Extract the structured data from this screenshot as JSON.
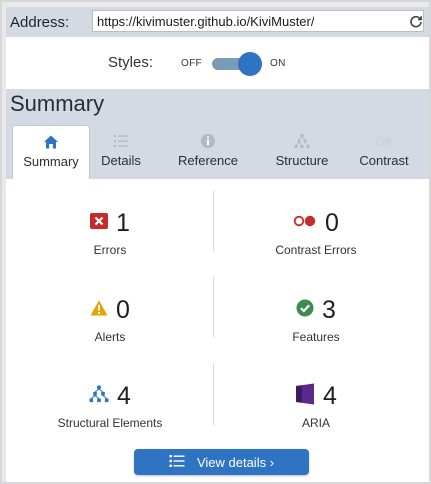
{
  "address": {
    "label": "Address:",
    "value": "https://kivimuster.github.io/KiviMuster/",
    "reload_icon": "reload-icon"
  },
  "styles": {
    "label": "Styles:",
    "off_label": "OFF",
    "on_label": "ON",
    "enabled": true
  },
  "summary": {
    "title": "Summary"
  },
  "tabs": [
    {
      "label": "Summary",
      "icon": "home-icon",
      "active": true
    },
    {
      "label": "Details",
      "icon": "list-icon",
      "active": false
    },
    {
      "label": "Reference",
      "icon": "info-icon",
      "active": false
    },
    {
      "label": "Structure",
      "icon": "hierarchy-icon",
      "active": false
    },
    {
      "label": "Contrast",
      "icon": "contrast-icon",
      "active": false
    }
  ],
  "metrics": {
    "errors": {
      "count": "1",
      "label": "Errors",
      "icon": "error-icon",
      "color": "#c62b2b"
    },
    "contrast_errors": {
      "count": "0",
      "label": "Contrast Errors",
      "icon": "contrast-icon",
      "color": "#c62b2b"
    },
    "alerts": {
      "count": "0",
      "label": "Alerts",
      "icon": "alert-icon",
      "color": "#e7a300"
    },
    "features": {
      "count": "3",
      "label": "Features",
      "icon": "check-icon",
      "color": "#3d8b4d"
    },
    "structural": {
      "count": "4",
      "label": "Structural Elements",
      "icon": "hierarchy-icon",
      "color": "#2f73c3"
    },
    "aria": {
      "count": "4",
      "label": "ARIA",
      "icon": "aria-icon",
      "color": "#5a2a8a"
    }
  },
  "view_details": {
    "label": "View details ›",
    "icon": "list-icon"
  },
  "colors": {
    "accent": "#2f73c3",
    "panel": "#d3dae3"
  }
}
